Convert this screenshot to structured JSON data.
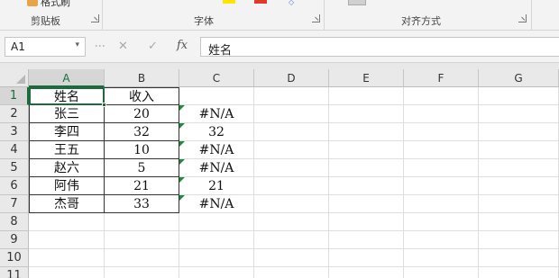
{
  "ribbon": {
    "format_painter": "格式刷",
    "groups": [
      {
        "label": "剪贴板"
      },
      {
        "label": "字体"
      },
      {
        "label": "对齐方式"
      }
    ],
    "font_color_swatches": [
      "#ffe600",
      "#e03a2d"
    ]
  },
  "formula_bar": {
    "name_box": "A1",
    "cancel_icon": "✕",
    "enter_icon": "✓",
    "fx_label": "fx",
    "content": "姓名"
  },
  "sheet": {
    "columns": [
      "A",
      "B",
      "C",
      "D",
      "E",
      "F",
      "G"
    ],
    "rows": [
      "1",
      "2",
      "3",
      "4",
      "5",
      "6",
      "7",
      "8",
      "9",
      "10",
      "11"
    ],
    "cells": {
      "A": [
        "姓名",
        "张三",
        "李四",
        "王五",
        "赵六",
        "阿伟",
        "杰哥"
      ],
      "B": [
        "收入",
        "20",
        "32",
        "10",
        "5",
        "21",
        "33"
      ],
      "C": [
        "",
        "#N/A",
        "32",
        "#N/A",
        "#N/A",
        "21",
        "#N/A"
      ]
    },
    "selected_cell": "A1",
    "error_indicator_color": "#1e8a3c"
  }
}
